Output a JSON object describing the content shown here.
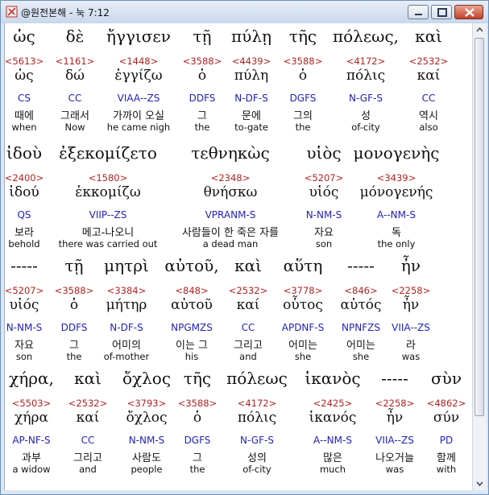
{
  "window": {
    "title": "@원전본해 - 눅 7:12",
    "controls": [
      "minimize",
      "maximize",
      "close"
    ],
    "icons": {
      "app": "bible-app-icon",
      "minimize": "minimize-icon",
      "maximize": "maximize-icon",
      "close": "close-icon"
    }
  },
  "rows": [
    {
      "top": [
        "ὡς",
        "δὲ",
        "ἤγγισεν",
        "τῇ",
        "πύλῃ",
        "τῆς",
        "πόλεως,",
        "καὶ"
      ],
      "num": [
        "<5613>",
        "<1161>",
        "<1448>",
        "<3588>",
        "<4439>",
        "<3588>",
        "<4172>",
        "<2532>"
      ],
      "lemma": [
        "ὡς",
        "δώ",
        "ἐγγίζω",
        "ὁ",
        "πύλη",
        "ὁ",
        "πόλις",
        "καί"
      ],
      "morph": [
        "CS",
        "CC",
        "VIAA--ZS",
        "DDFS",
        "N-DF-S",
        "DGFS",
        "N-GF-S",
        "CC"
      ],
      "kor": [
        "때에",
        "그래서",
        "가까이 오실",
        "그",
        "문에",
        "그의",
        "성",
        "역시"
      ],
      "eng": [
        "when",
        "Now",
        "he came nigh",
        "the",
        "to-gate",
        "the",
        "of-city",
        "also"
      ]
    },
    {
      "top": [
        "ἰδοὺ",
        "ἐξεκομίζετο",
        "τεθνηκὼς",
        "υἱὸς",
        "μονογενὴς"
      ],
      "num": [
        "<2400>",
        "<1580>",
        "<2348>",
        "<5207>",
        "<3439>"
      ],
      "lemma": [
        "ἰδού",
        "ἐκκομίζω",
        "θνήσκω",
        "υἱός",
        "μόνογενής"
      ],
      "morph": [
        "QS",
        "VIIP--ZS",
        "VPRANM-S",
        "N-NM-S",
        "A--NM-S"
      ],
      "kor": [
        "보라",
        "메고-나오니",
        "사람들이 한 죽은 자를",
        "자요",
        "독"
      ],
      "eng": [
        "behold",
        "there was carried out",
        "a dead man",
        "son",
        "the only"
      ]
    },
    {
      "top": [
        "-----",
        "τῇ",
        "μητρὶ",
        "αὐτοῦ,",
        "καὶ",
        "αὕτη",
        "-----",
        "ἦν"
      ],
      "num": [
        "<5207>",
        "<3588>",
        "<3384>",
        "<848>",
        "<2532>",
        "<3778>",
        "<846>",
        "<2258>"
      ],
      "lemma": [
        "υἱός",
        "ὁ",
        "μήτηρ",
        "αὐτοῦ",
        "καί",
        "οὗτος",
        "αὐτός",
        "ἦν"
      ],
      "morph": [
        "N-NM-S",
        "DDFS",
        "N-DF-S",
        "NPGMZS",
        "CC",
        "APDNF-S",
        "NPNFZS",
        "VIIA--ZS"
      ],
      "kor": [
        "자요",
        "그",
        "어미의",
        "이는 그",
        "그리고",
        "어미는",
        "어미는",
        "라"
      ],
      "eng": [
        "son",
        "the",
        "of-mother",
        "his",
        "and",
        "she",
        "she",
        "was"
      ]
    },
    {
      "top": [
        "χήρα,",
        "καὶ",
        "ὄχλος",
        "τῆς",
        "πόλεως",
        "ἱκανὸς",
        "-----",
        "σὺν"
      ],
      "num": [
        "<5503>",
        "<2532>",
        "<3793>",
        "<3588>",
        "<4172>",
        "<2425>",
        "<2258>",
        "<4862>"
      ],
      "lemma": [
        "χήρα",
        "καί",
        "ὄχλος",
        "ὁ",
        "πόλις",
        "ἱκανός",
        "ἦν",
        "σύν"
      ],
      "morph": [
        "AP-NF-S",
        "CC",
        "N-NM-S",
        "DGFS",
        "N-GF-S",
        "A--NM-S",
        "VIIA--ZS",
        "PD"
      ],
      "kor": [
        "과부",
        "그리고",
        "사람도",
        "그",
        "성의",
        "많은",
        "나오거늘",
        "함께"
      ],
      "eng": [
        "a widow",
        "and",
        "people",
        "the",
        "of-city",
        "much",
        "was",
        "with"
      ]
    }
  ]
}
